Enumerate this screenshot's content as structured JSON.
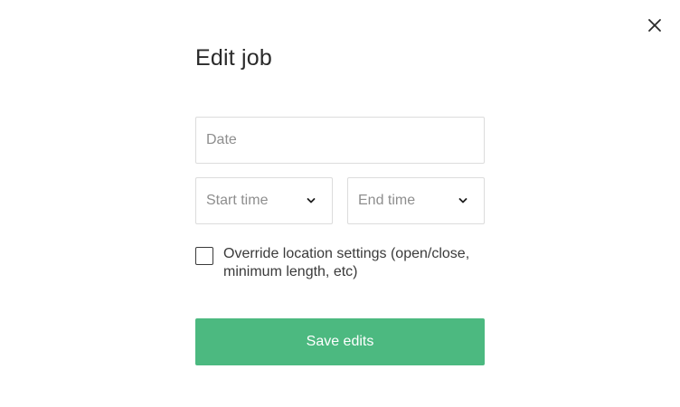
{
  "dialog": {
    "title": "Edit job",
    "close_icon": "close-icon"
  },
  "form": {
    "date_placeholder": "Date",
    "start_time_placeholder": "Start time",
    "end_time_placeholder": "End time",
    "dropdown_icon": "chevron-down-icon",
    "override_label": "Override location settings (open/close, minimum length, etc)",
    "override_checked": false
  },
  "actions": {
    "save_label": "Save edits"
  },
  "colors": {
    "accent": "#4cb980",
    "border": "#dcdcdc",
    "placeholder": "#8e8e8e",
    "text": "#2a2a2a"
  }
}
